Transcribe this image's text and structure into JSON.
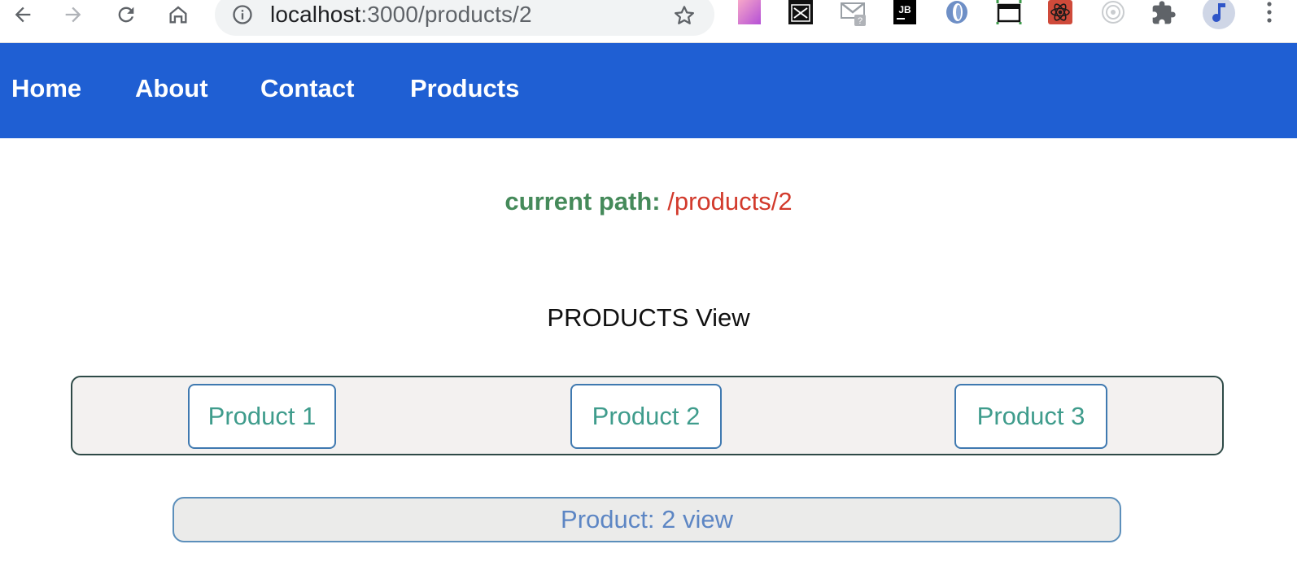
{
  "browser": {
    "url_host": "localhost",
    "url_path": ":3000/products/2",
    "extensions": [
      "color-palette-icon",
      "window-resizer-icon",
      "gmail-checker-icon",
      "jetbrains-icon",
      "wave-extension-icon",
      "screen-capture-icon",
      "react-devtools-icon",
      "target-icon",
      "puzzle-extensions-icon",
      "music-avatar-icon"
    ]
  },
  "nav": {
    "home": "Home",
    "about": "About",
    "contact": "Contact",
    "products": "Products"
  },
  "current_path": {
    "label": "current path:",
    "value": "/products/2"
  },
  "view_title": "PRODUCTS View",
  "products": [
    {
      "label": "Product 1"
    },
    {
      "label": "Product 2"
    },
    {
      "label": "Product 3"
    }
  ],
  "detail": "Product: 2 view",
  "colors": {
    "nav_background": "#1f5fd3",
    "path_label": "#458a5a",
    "path_value": "#d23a2c",
    "product_text": "#3f9c8c",
    "detail_text": "#5d86c4"
  }
}
